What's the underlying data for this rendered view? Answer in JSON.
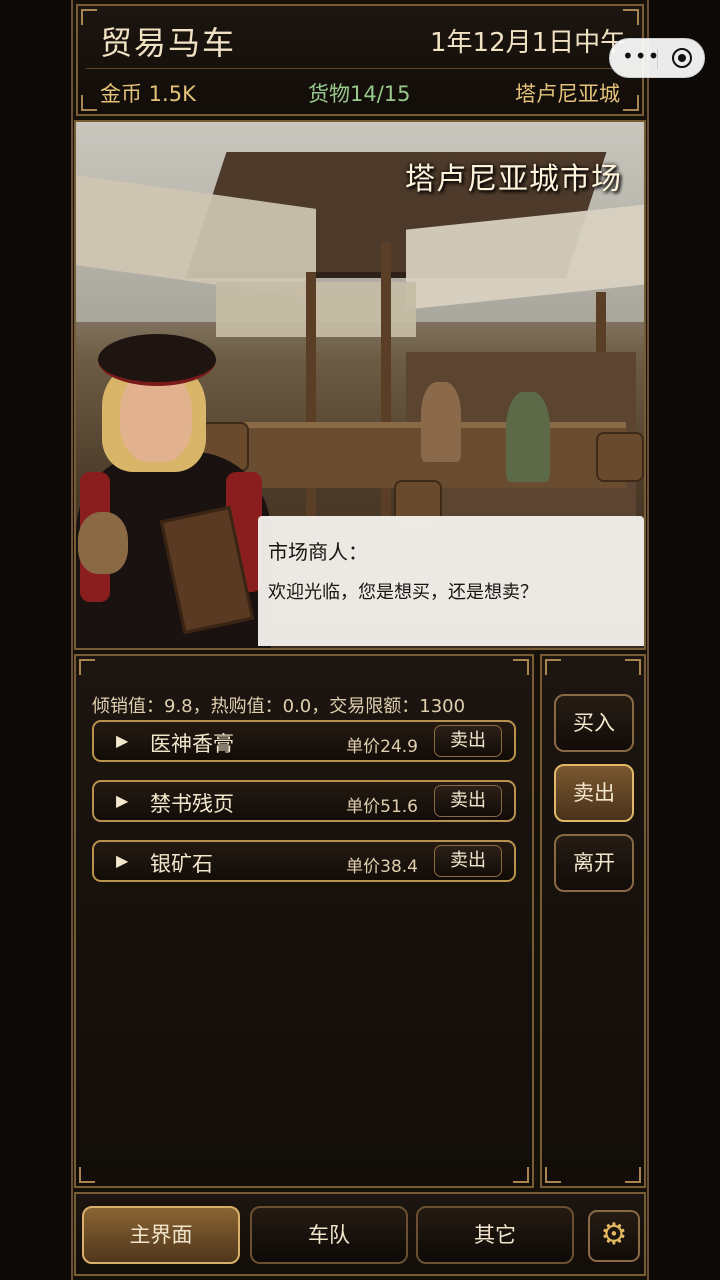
{
  "header": {
    "title": "贸易马车",
    "date": "1年12月1日中午",
    "gold": "金币 1.5K",
    "cargo": "货物14/15",
    "city": "塔卢尼亚城"
  },
  "capsule": {
    "more_icon": "more-dots-icon",
    "close_icon": "target-circle-icon"
  },
  "scene": {
    "title": "塔卢尼亚城市场",
    "speaker": "市场商人：",
    "speech": "欢迎光临，您是想买，还是想卖？"
  },
  "trade": {
    "indices": "倾销值：9.8，热购值：0.0，交易限额：1300",
    "items": [
      {
        "name": "医神香膏",
        "price": "单价24.9",
        "action": "卖出"
      },
      {
        "name": "禁书残页",
        "price": "单价51.6",
        "action": "卖出"
      },
      {
        "name": "银矿石",
        "price": "单价38.4",
        "action": "卖出"
      }
    ]
  },
  "side_buttons": {
    "buy": "买入",
    "sell": "卖出",
    "leave": "离开",
    "active": "sell"
  },
  "nav": {
    "main": "主界面",
    "fleet": "车队",
    "other": "其它",
    "settings_icon": "gear-icon",
    "active": "main"
  },
  "colors": {
    "accent_gold": "#b8924e",
    "cargo_green": "#98c88c",
    "active_button": "#7a5830"
  }
}
